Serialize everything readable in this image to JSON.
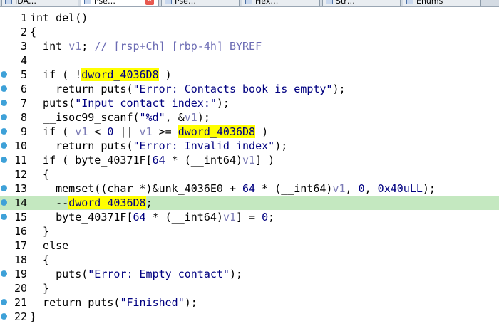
{
  "tabs": [
    {
      "label": "IDA…",
      "active": false
    },
    {
      "label": "Pse…",
      "active": true
    },
    {
      "label": "Pse…",
      "active": false
    },
    {
      "label": "Hex…",
      "active": false
    },
    {
      "label": "Str…",
      "active": false
    },
    {
      "label": "Enums",
      "active": false
    }
  ],
  "current_line": 14,
  "lines": [
    {
      "n": "1",
      "bp": false,
      "t": "int del()"
    },
    {
      "n": "2",
      "bp": false,
      "t": "{"
    },
    {
      "n": "3",
      "bp": false,
      "t": "  int v1; // [rsp+Ch] [rbp-4h] BYREF"
    },
    {
      "n": "4",
      "bp": false,
      "t": ""
    },
    {
      "n": "5",
      "bp": true,
      "t": "  if ( !dword_4036D8 )"
    },
    {
      "n": "6",
      "bp": true,
      "t": "    return puts(\"Error: Contacts book is empty\");"
    },
    {
      "n": "7",
      "bp": true,
      "t": "  puts(\"Input contact index:\");"
    },
    {
      "n": "8",
      "bp": true,
      "t": "  __isoc99_scanf(\"%d\", &v1);"
    },
    {
      "n": "9",
      "bp": true,
      "t": "  if ( v1 < 0 || v1 >= dword_4036D8 )"
    },
    {
      "n": "10",
      "bp": true,
      "t": "    return puts(\"Error: Invalid index\");"
    },
    {
      "n": "11",
      "bp": true,
      "t": "  if ( byte_40371F[64 * (__int64)v1] )"
    },
    {
      "n": "12",
      "bp": false,
      "t": "  {"
    },
    {
      "n": "13",
      "bp": true,
      "t": "    memset((char *)&unk_4036E0 + 64 * (__int64)v1, 0, 0x40uLL);"
    },
    {
      "n": "14",
      "bp": true,
      "t": "    --dword_4036D8;"
    },
    {
      "n": "15",
      "bp": true,
      "t": "    byte_40371F[64 * (__int64)v1] = 0;"
    },
    {
      "n": "16",
      "bp": false,
      "t": "  }"
    },
    {
      "n": "17",
      "bp": false,
      "t": "  else"
    },
    {
      "n": "18",
      "bp": false,
      "t": "  {"
    },
    {
      "n": "19",
      "bp": true,
      "t": "    puts(\"Error: Empty contact\");"
    },
    {
      "n": "20",
      "bp": false,
      "t": "  }"
    },
    {
      "n": "21",
      "bp": true,
      "t": "  return puts(\"Finished\");"
    },
    {
      "n": "22",
      "bp": true,
      "t": "}"
    }
  ],
  "highlight_symbol": "dword_4036D8",
  "colors": {
    "breakpoint": "#3ea1d8",
    "current_line": "#c4e8c0",
    "highlight": "#ffff00"
  }
}
